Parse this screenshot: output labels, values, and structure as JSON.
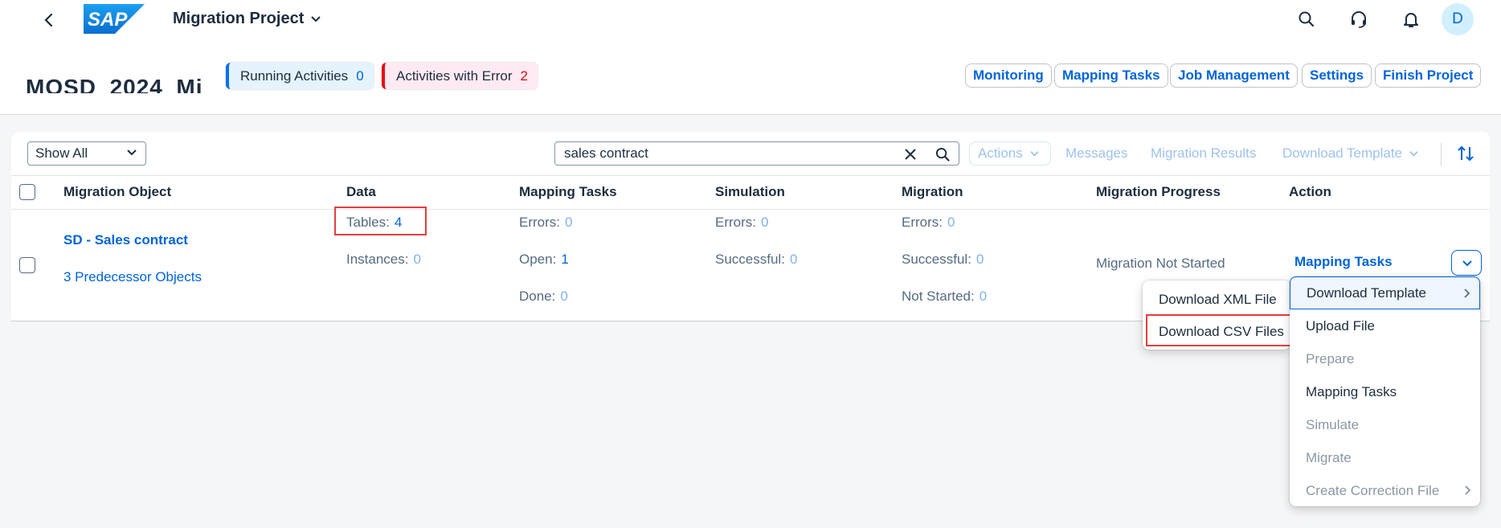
{
  "shell": {
    "logo_text": "SAP",
    "project_title": "Migration Project",
    "avatar_initial": "D"
  },
  "header": {
    "title_cut": "MOSD_2024_Mi",
    "running_label": "Running Activities",
    "running_count": "0",
    "error_label": "Activities with Error",
    "error_count": "2",
    "buttons": [
      "Monitoring",
      "Mapping Tasks",
      "Job Management",
      "Settings",
      "Finish Project"
    ]
  },
  "toolbar": {
    "filter_value": "Show All",
    "search_value": "sales contract",
    "actions": "Actions",
    "messages": "Messages",
    "migration_results": "Migration Results",
    "download_template": "Download Template"
  },
  "table": {
    "columns": [
      "Migration Object",
      "Data",
      "Mapping Tasks",
      "Simulation",
      "Migration",
      "Migration Progress",
      "Action"
    ],
    "row": {
      "object_name": "SD - Sales contract",
      "predecessors": "3 Predecessor Objects",
      "data_tables_label": "Tables:",
      "data_tables_value": "4",
      "data_instances_label": "Instances:",
      "data_instances_value": "0",
      "mt_errors_label": "Errors:",
      "mt_errors_value": "0",
      "mt_open_label": "Open:",
      "mt_open_value": "1",
      "mt_done_label": "Done:",
      "mt_done_value": "0",
      "sim_errors_label": "Errors:",
      "sim_errors_value": "0",
      "sim_successful_label": "Successful:",
      "sim_successful_value": "0",
      "mig_errors_label": "Errors:",
      "mig_errors_value": "0",
      "mig_successful_label": "Successful:",
      "mig_successful_value": "0",
      "mig_not_started_label": "Not Started:",
      "mig_not_started_value": "0",
      "progress": "Migration Not Started",
      "action_link": "Mapping Tasks"
    }
  },
  "submenu": {
    "items": [
      "Download XML File",
      "Download CSV Files"
    ]
  },
  "action_menu": {
    "items": [
      {
        "label": "Download Template",
        "enabled": true
      },
      {
        "label": "Upload File",
        "enabled": true
      },
      {
        "label": "Prepare",
        "enabled": false
      },
      {
        "label": "Mapping Tasks",
        "enabled": true
      },
      {
        "label": "Simulate",
        "enabled": false
      },
      {
        "label": "Migrate",
        "enabled": false
      },
      {
        "label": "Create Correction File",
        "enabled": false
      }
    ]
  },
  "colors": {
    "accent": "#0064d9",
    "error": "#e90b0b",
    "highlight": "#e53e3e"
  }
}
